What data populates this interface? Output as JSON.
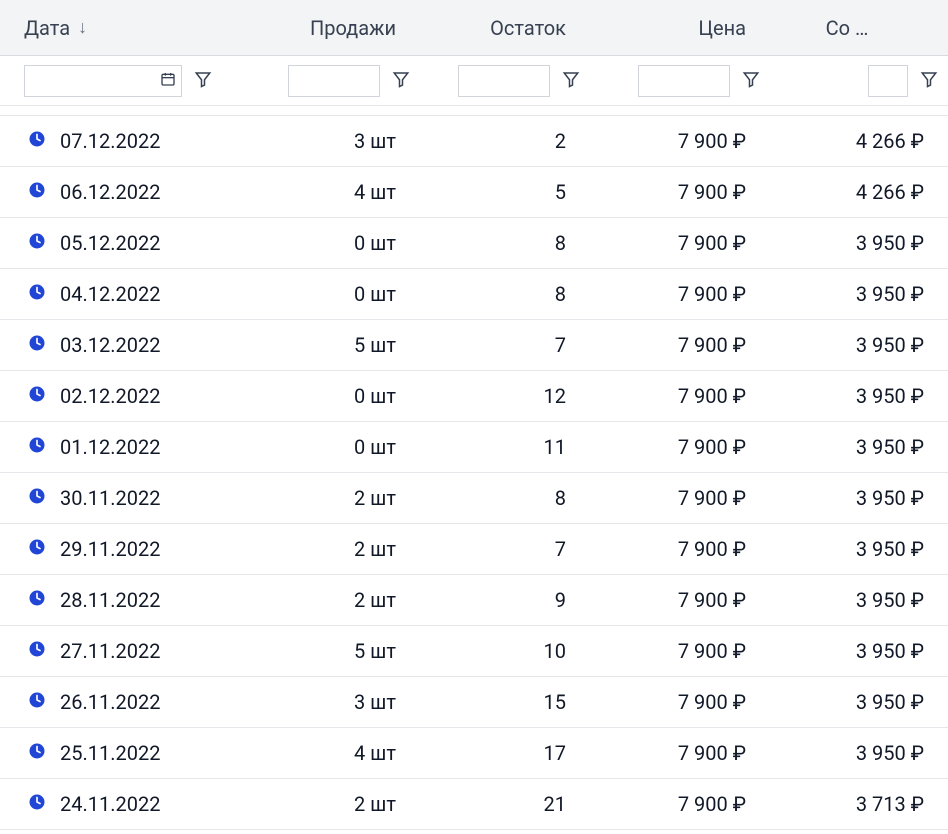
{
  "columns": {
    "date": "Дата",
    "sales": "Продажи",
    "stock": "Остаток",
    "price": "Цена",
    "cost": "Со …"
  },
  "sortIndicator": "↓",
  "salesUnit": "шт",
  "currency": "₽",
  "rows": [
    {
      "date": "07.12.2022",
      "sales": 3,
      "stock": 2,
      "price": "7 900",
      "cost": "4 266"
    },
    {
      "date": "06.12.2022",
      "sales": 4,
      "stock": 5,
      "price": "7 900",
      "cost": "4 266"
    },
    {
      "date": "05.12.2022",
      "sales": 0,
      "stock": 8,
      "price": "7 900",
      "cost": "3 950"
    },
    {
      "date": "04.12.2022",
      "sales": 0,
      "stock": 8,
      "price": "7 900",
      "cost": "3 950"
    },
    {
      "date": "03.12.2022",
      "sales": 5,
      "stock": 7,
      "price": "7 900",
      "cost": "3 950"
    },
    {
      "date": "02.12.2022",
      "sales": 0,
      "stock": 12,
      "price": "7 900",
      "cost": "3 950"
    },
    {
      "date": "01.12.2022",
      "sales": 0,
      "stock": 11,
      "price": "7 900",
      "cost": "3 950"
    },
    {
      "date": "30.11.2022",
      "sales": 2,
      "stock": 8,
      "price": "7 900",
      "cost": "3 950"
    },
    {
      "date": "29.11.2022",
      "sales": 2,
      "stock": 7,
      "price": "7 900",
      "cost": "3 950"
    },
    {
      "date": "28.11.2022",
      "sales": 2,
      "stock": 9,
      "price": "7 900",
      "cost": "3 950"
    },
    {
      "date": "27.11.2022",
      "sales": 5,
      "stock": 10,
      "price": "7 900",
      "cost": "3 950"
    },
    {
      "date": "26.11.2022",
      "sales": 3,
      "stock": 15,
      "price": "7 900",
      "cost": "3 950"
    },
    {
      "date": "25.11.2022",
      "sales": 4,
      "stock": 17,
      "price": "7 900",
      "cost": "3 950"
    },
    {
      "date": "24.11.2022",
      "sales": 2,
      "stock": 21,
      "price": "7 900",
      "cost": "3 713"
    }
  ]
}
